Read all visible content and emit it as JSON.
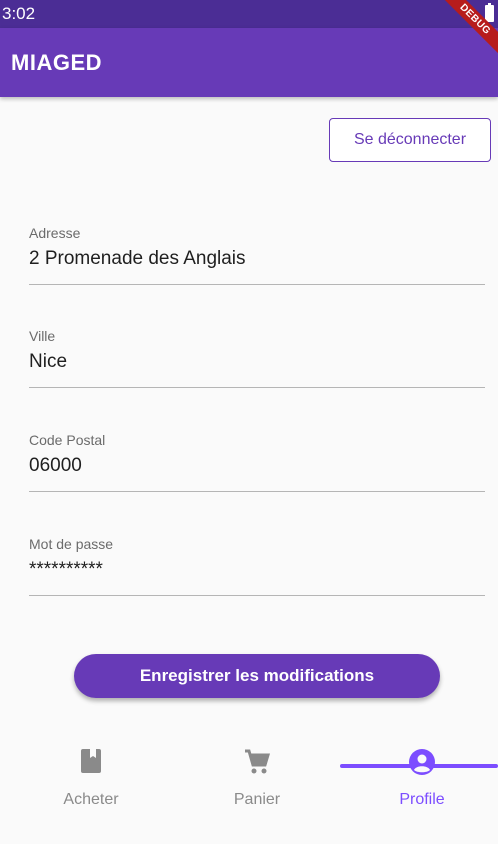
{
  "status_bar": {
    "time": "3:02"
  },
  "app_bar": {
    "title": "MIAGED",
    "debug_label": "DEBUG"
  },
  "logout_button": {
    "label": "Se déconnecter"
  },
  "form": {
    "fields": [
      {
        "label": "Adresse",
        "value": "2 Promenade des Anglais"
      },
      {
        "label": "Ville",
        "value": "Nice"
      },
      {
        "label": "Code Postal",
        "value": "06000"
      },
      {
        "label": "Mot de passe",
        "value": "**********"
      }
    ]
  },
  "save_button": {
    "label": "Enregistrer les modifications"
  },
  "bottom_nav": {
    "items": [
      {
        "label": "Acheter",
        "icon": "book-icon"
      },
      {
        "label": "Panier",
        "icon": "cart-icon"
      },
      {
        "label": "Profile",
        "icon": "account-circle-icon"
      }
    ],
    "active_index": 2
  },
  "colors": {
    "primary": "#673ab7",
    "status_bar": "#4b2d95",
    "accent": "#7c4dff",
    "debug": "#b71c1c"
  }
}
